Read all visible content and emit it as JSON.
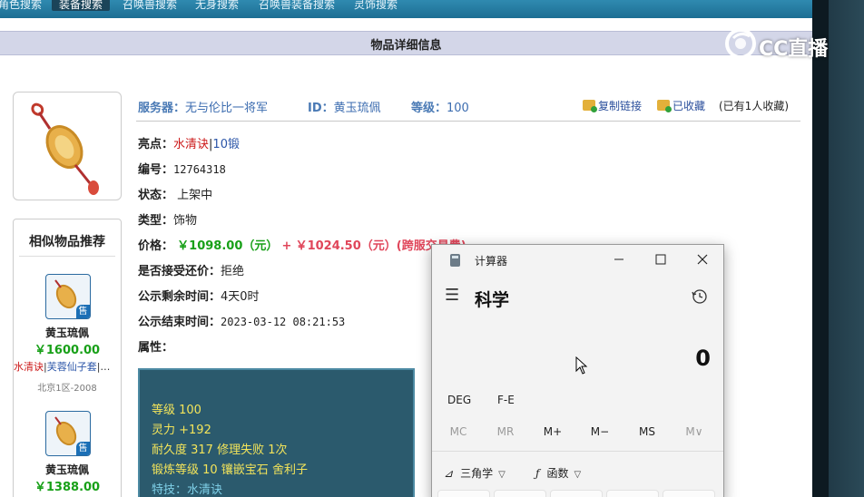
{
  "nav": {
    "items": [
      "角色搜索",
      "装备搜索",
      "召唤兽搜索",
      "无身搜索",
      "召唤兽装备搜索",
      "灵饰搜索"
    ],
    "active_index": 1
  },
  "page_title": "物品详细信息",
  "item": {
    "server_label": "服务器：",
    "server": "无与伦比一将军",
    "id_label": "ID：",
    "id": "黄玉琉佩",
    "level_label": "等级：",
    "level": "100",
    "copy_link": "复制链接",
    "favorited": "已收藏",
    "fav_count": "(已有1人收藏)",
    "highlight_label": "亮点：",
    "highlight_red": "水清诀",
    "highlight_sep": "|",
    "highlight_blue": "10锻",
    "number_label": "编号：",
    "number": "12764318",
    "status_label": "状态：",
    "status": "上架中",
    "type_label": "类型：",
    "type": "饰物",
    "price_label": "价格：",
    "price_main": "￥1098.00（元）",
    "price_plus": "+",
    "price_fee": "￥1024.50（元）(跨服交易费)",
    "counter_label": "是否接受还价：",
    "counter": "拒绝",
    "remaining_label": "公示剩余时间：",
    "remaining": "4天0时",
    "end_label": "公示结束时间：",
    "end": "2023-03-12 08:21:53",
    "attr_label": "属性："
  },
  "attributes": [
    "等级 100",
    "灵力 +192",
    "耐久度 317  修理失败 1次",
    "锻炼等级 10  镶嵌宝石 舍利子",
    "特技：水清诀"
  ],
  "similar": {
    "title": "相似物品推荐",
    "sale_badge": "售",
    "items": [
      {
        "name": "黄玉琉佩",
        "price": "￥1600.00",
        "tag_red": "水清诀",
        "tag_sep": "|",
        "tag_blue": "芙蓉仙子套",
        "tag_rest": "|…",
        "server": "北京1区-2008"
      },
      {
        "name": "黄玉琉佩",
        "price": "￥1388.00"
      }
    ]
  },
  "calculator": {
    "title": "计算器",
    "mode": "科学",
    "display": "0",
    "func_row": [
      "DEG",
      "F-E"
    ],
    "memory": [
      "MC",
      "MR",
      "M+",
      "M−",
      "MS",
      "M∨"
    ],
    "memory_enabled": [
      false,
      false,
      true,
      true,
      true,
      false
    ],
    "trig_label": "三角学",
    "func_label": "函数"
  },
  "watermark": {
    "text": "CC直播"
  },
  "colors": {
    "nav_bg": "#1d6e93",
    "title_bar": "#d3d6e8",
    "price_green": "#18a018",
    "highlight_red": "#cc1a1a",
    "attr_panel": "#2b5a6d",
    "attr_text": "#f3e45a"
  }
}
